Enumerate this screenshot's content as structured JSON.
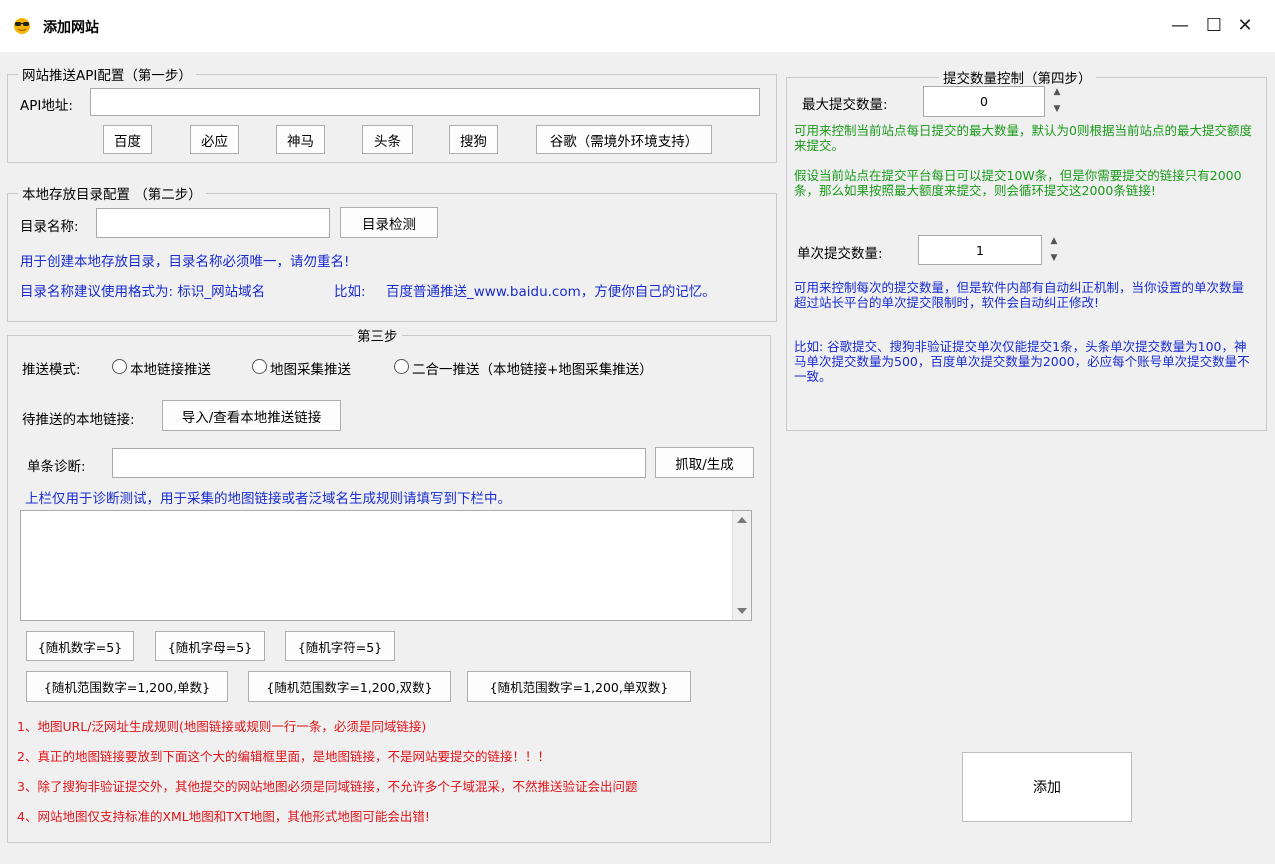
{
  "window": {
    "title": "添加网站",
    "minimize": "—",
    "maximize": "☐",
    "close": "✕"
  },
  "step1": {
    "legend": "网站推送API配置（第一步）",
    "api_label": "API地址:",
    "api_value": "",
    "buttons": [
      "百度",
      "必应",
      "神马",
      "头条",
      "搜狗",
      "谷歌（需境外环境支持）"
    ]
  },
  "step2": {
    "legend": "本地存放目录配置 （第二步）",
    "dir_label": "目录名称:",
    "dir_value": "",
    "check_button": "目录检测",
    "note1": "用于创建本地存放目录，目录名称必须唯一，请勿重名!",
    "note2_prefix": "目录名称建议使用格式为: 标识_网站域名",
    "note2_example_label": "比如:",
    "note2_example": "百度普通推送_www.baidu.com，方便你自己的记忆。"
  },
  "step3": {
    "legend": "第三步",
    "mode_label": "推送模式:",
    "modes": [
      "本地链接推送",
      "地图采集推送",
      "二合一推送（本地链接+地图采集推送）"
    ],
    "local_label": "待推送的本地链接:",
    "import_button": "导入/查看本地推送链接",
    "diag_label": "单条诊断:",
    "diag_value": "",
    "fetch_button": "抓取/生成",
    "hint": "上栏仅用于诊断测试，用于采集的地图链接或者泛域名生成规则请填写到下栏中。",
    "textarea_value": "",
    "tags_row1": [
      "{随机数字=5}",
      "{随机字母=5}",
      "{随机字符=5}"
    ],
    "tags_row2": [
      "{随机范围数字=1,200,单数}",
      "{随机范围数字=1,200,双数}",
      "{随机范围数字=1,200,单双数}"
    ],
    "rules": [
      "1、地图URL/泛网址生成规则(地图链接或规则一行一条，必须是同域链接)",
      "2、真正的地图链接要放到下面这个大的编辑框里面，是地图链接，不是网站要提交的链接！！！",
      "3、除了搜狗非验证提交外，其他提交的网站地图必须是同域链接，不允许多个子域混采，不然推送验证会出问题",
      "4、网站地图仅支持标准的XML地图和TXT地图，其他形式地图可能会出错!"
    ]
  },
  "step4": {
    "legend": "提交数量控制（第四步）",
    "max_label": "最大提交数量:",
    "max_value": "0",
    "green1": "可用来控制当前站点每日提交的最大数量，默认为0则根据当前站点的最大提交额度来提交。",
    "green2": "假设当前站点在提交平台每日可以提交10W条，但是你需要提交的链接只有2000条，那么如果按照最大额度来提交，则会循环提交这2000条链接!",
    "single_label": "单次提交数量:",
    "single_value": "1",
    "blue1": "可用来控制每次的提交数量，但是软件内部有自动纠正机制，当你设置的单次数量超过站长平台的单次提交限制时，软件会自动纠正修改!",
    "blue2": "比如: 谷歌提交、搜狗非验证提交单次仅能提交1条，头条单次提交数量为100，神马单次提交数量为500，百度单次提交数量为2000，必应每个账号单次提交数量不一致。"
  },
  "add_button": "添加",
  "colors": {
    "green": "#1a9a1a",
    "blue": "#1a2bd0",
    "red": "#e0141a"
  }
}
